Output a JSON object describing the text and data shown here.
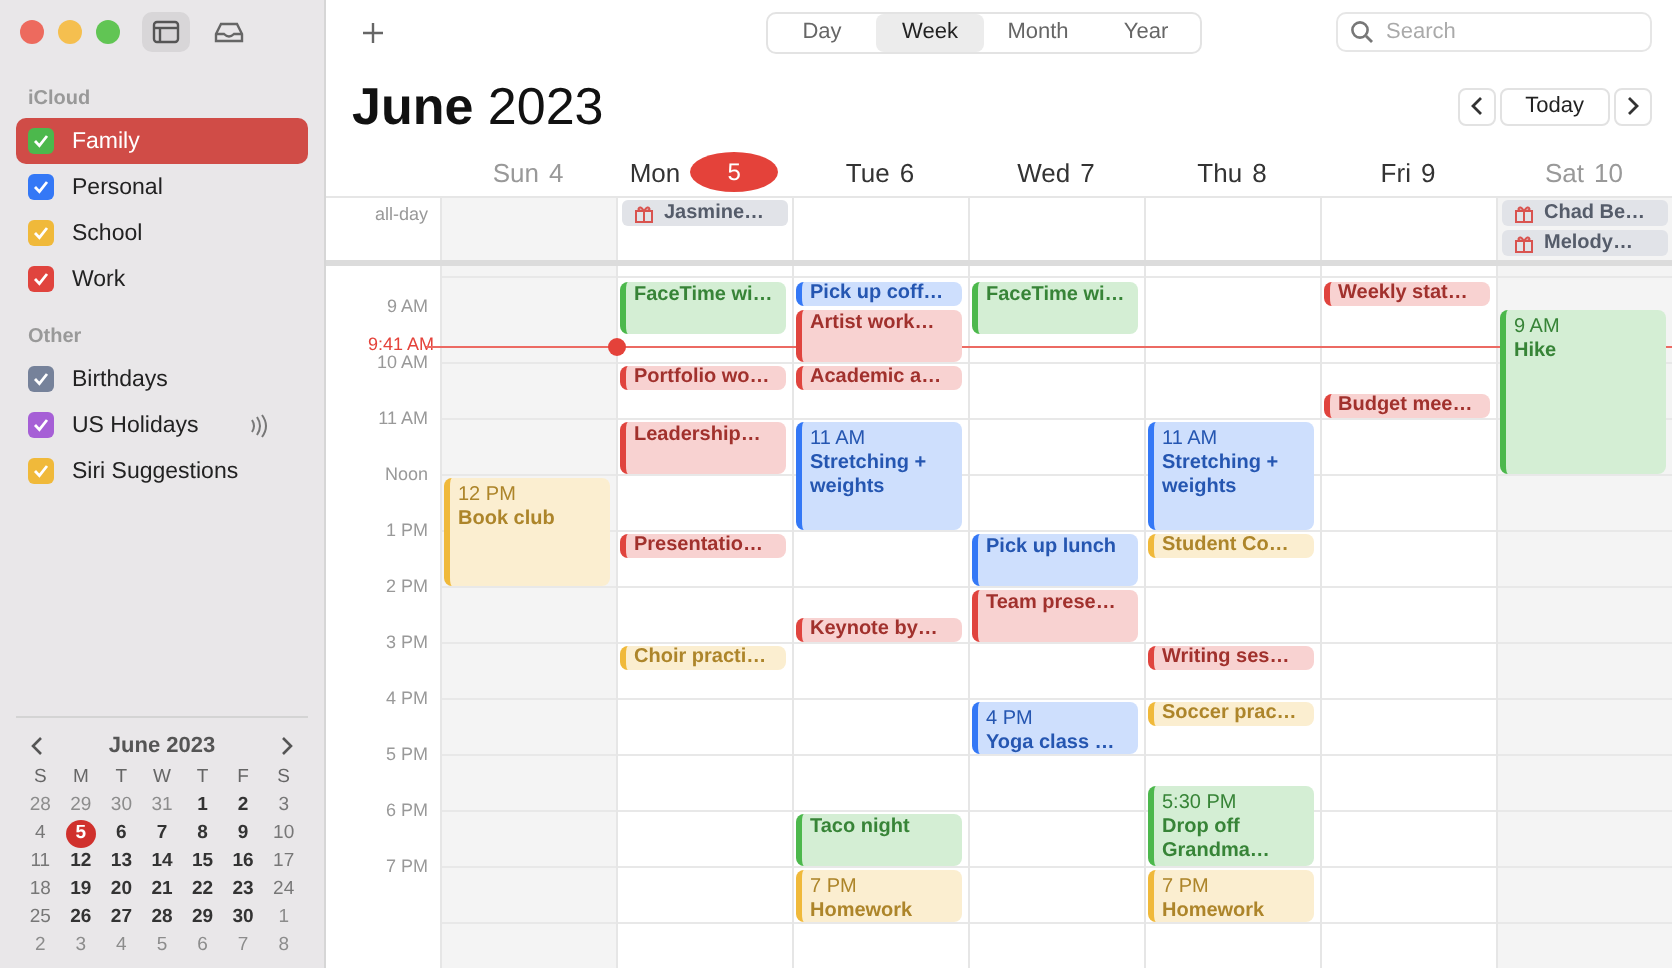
{
  "sidebar": {
    "sections": [
      {
        "title": "iCloud",
        "calendars": [
          {
            "name": "Family",
            "color": "#4cb84c",
            "checked": true,
            "selected": true,
            "shared": false
          },
          {
            "name": "Personal",
            "color": "#3478f6",
            "checked": true,
            "selected": false,
            "shared": false
          },
          {
            "name": "School",
            "color": "#f0b93a",
            "checked": true,
            "selected": false,
            "shared": false
          },
          {
            "name": "Work",
            "color": "#e0443e",
            "checked": true,
            "selected": false,
            "shared": false
          }
        ]
      },
      {
        "title": "Other",
        "calendars": [
          {
            "name": "Birthdays",
            "color": "#76829a",
            "checked": true,
            "selected": false,
            "shared": false
          },
          {
            "name": "US Holidays",
            "color": "#a65fd6",
            "checked": true,
            "selected": false,
            "shared": true
          },
          {
            "name": "Siri Suggestions",
            "color": "#f0b93a",
            "checked": true,
            "selected": false,
            "shared": false
          }
        ]
      }
    ],
    "mini_calendar": {
      "title": "June 2023",
      "weekdays": [
        "S",
        "M",
        "T",
        "W",
        "T",
        "F",
        "S"
      ],
      "weeks": [
        [
          {
            "d": "28",
            "in_month": false,
            "selected": false
          },
          {
            "d": "29",
            "in_month": false,
            "selected": false
          },
          {
            "d": "30",
            "in_month": false,
            "selected": false
          },
          {
            "d": "31",
            "in_month": false,
            "selected": false
          },
          {
            "d": "1",
            "in_month": true,
            "selected": false
          },
          {
            "d": "2",
            "in_month": true,
            "selected": false
          },
          {
            "d": "3",
            "in_month": true,
            "selected": false
          }
        ],
        [
          {
            "d": "4",
            "in_month": true,
            "selected": false
          },
          {
            "d": "5",
            "in_month": true,
            "selected": true
          },
          {
            "d": "6",
            "in_month": true,
            "selected": false
          },
          {
            "d": "7",
            "in_month": true,
            "selected": false
          },
          {
            "d": "8",
            "in_month": true,
            "selected": false
          },
          {
            "d": "9",
            "in_month": true,
            "selected": false
          },
          {
            "d": "10",
            "in_month": true,
            "selected": false
          }
        ],
        [
          {
            "d": "11",
            "in_month": true,
            "selected": false
          },
          {
            "d": "12",
            "in_month": true,
            "selected": false
          },
          {
            "d": "13",
            "in_month": true,
            "selected": false
          },
          {
            "d": "14",
            "in_month": true,
            "selected": false
          },
          {
            "d": "15",
            "in_month": true,
            "selected": false
          },
          {
            "d": "16",
            "in_month": true,
            "selected": false
          },
          {
            "d": "17",
            "in_month": true,
            "selected": false
          }
        ],
        [
          {
            "d": "18",
            "in_month": true,
            "selected": false
          },
          {
            "d": "19",
            "in_month": true,
            "selected": false
          },
          {
            "d": "20",
            "in_month": true,
            "selected": false
          },
          {
            "d": "21",
            "in_month": true,
            "selected": false
          },
          {
            "d": "22",
            "in_month": true,
            "selected": false
          },
          {
            "d": "23",
            "in_month": true,
            "selected": false
          },
          {
            "d": "24",
            "in_month": true,
            "selected": false
          }
        ],
        [
          {
            "d": "25",
            "in_month": true,
            "selected": false
          },
          {
            "d": "26",
            "in_month": true,
            "selected": false
          },
          {
            "d": "27",
            "in_month": true,
            "selected": false
          },
          {
            "d": "28",
            "in_month": true,
            "selected": false
          },
          {
            "d": "29",
            "in_month": true,
            "selected": false
          },
          {
            "d": "30",
            "in_month": true,
            "selected": false
          },
          {
            "d": "1",
            "in_month": false,
            "selected": false
          }
        ],
        [
          {
            "d": "2",
            "in_month": false,
            "selected": false
          },
          {
            "d": "3",
            "in_month": false,
            "selected": false
          },
          {
            "d": "4",
            "in_month": false,
            "selected": false
          },
          {
            "d": "5",
            "in_month": false,
            "selected": false
          },
          {
            "d": "6",
            "in_month": false,
            "selected": false
          },
          {
            "d": "7",
            "in_month": false,
            "selected": false
          },
          {
            "d": "8",
            "in_month": false,
            "selected": false
          }
        ]
      ]
    }
  },
  "toolbar": {
    "views": [
      {
        "label": "Day",
        "selected": false
      },
      {
        "label": "Week",
        "selected": true
      },
      {
        "label": "Month",
        "selected": false
      },
      {
        "label": "Year",
        "selected": false
      }
    ],
    "search": {
      "placeholder": "Search"
    }
  },
  "title": "**June** 2023",
  "today_button": "Today",
  "all_day_label": "all-day",
  "hours": [
    "9 AM",
    "10 AM",
    "11 AM",
    "Noon",
    "1 PM",
    "2 PM",
    "3 PM",
    "4 PM",
    "5 PM",
    "6 PM",
    "7 PM"
  ],
  "now": {
    "label": "9:41 AM"
  },
  "days": [
    {
      "name": "Sun",
      "date": "4",
      "weekend": true,
      "today": false,
      "events": [
        {
          "title": "Book club",
          "time": "12 PM",
          "color": "#f0b93a"
        }
      ]
    },
    {
      "name": "Mon",
      "date": "5",
      "weekend": false,
      "today": true,
      "all_day": [
        {
          "title": "Jasmine…",
          "kind": "birthday"
        }
      ],
      "events": [
        {
          "title": "FaceTime wi…",
          "color": "#4cb84c"
        },
        {
          "title": "Portfolio wo…",
          "color": "#e0443e"
        },
        {
          "title": "Leadership…",
          "color": "#e0443e"
        },
        {
          "title": "Presentatio…",
          "color": "#e0443e"
        },
        {
          "title": "Choir practi…",
          "color": "#f0b93a"
        }
      ]
    },
    {
      "name": "Tue",
      "date": "6",
      "weekend": false,
      "today": false,
      "events": [
        {
          "title": "Pick up coff…",
          "color": "#3478f6"
        },
        {
          "title": "Artist work…",
          "color": "#e0443e"
        },
        {
          "title": "Academic a…",
          "color": "#e0443e"
        },
        {
          "title": "Stretching + weights",
          "time": "11 AM",
          "color": "#3478f6"
        },
        {
          "title": "Keynote by…",
          "color": "#e0443e"
        },
        {
          "title": "Taco night",
          "color": "#4cb84c"
        },
        {
          "title": "Homework",
          "time": "7 PM",
          "color": "#f0b93a"
        }
      ]
    },
    {
      "name": "Wed",
      "date": "7",
      "weekend": false,
      "today": false,
      "events": [
        {
          "title": "FaceTime wi…",
          "color": "#4cb84c"
        },
        {
          "title": "Pick up lunch",
          "color": "#3478f6"
        },
        {
          "title": "Team prese…",
          "color": "#e0443e"
        },
        {
          "title": "Yoga class …",
          "time": "4 PM",
          "color": "#3478f6"
        }
      ]
    },
    {
      "name": "Thu",
      "date": "8",
      "weekend": false,
      "today": false,
      "events": [
        {
          "title": "Stretching + weights",
          "time": "11 AM",
          "color": "#3478f6"
        },
        {
          "title": "Student Co…",
          "color": "#f0b93a"
        },
        {
          "title": "Writing ses…",
          "color": "#e0443e"
        },
        {
          "title": "Soccer prac…",
          "color": "#f0b93a"
        },
        {
          "title": "Drop off Grandma…",
          "time": "5:30 PM",
          "color": "#4cb84c"
        },
        {
          "title": "Homework",
          "time": "7 PM",
          "color": "#f0b93a"
        }
      ]
    },
    {
      "name": "Fri",
      "date": "9",
      "weekend": false,
      "today": false,
      "events": [
        {
          "title": "Weekly stat…",
          "color": "#e0443e"
        },
        {
          "title": "Budget mee…",
          "color": "#e0443e"
        }
      ]
    },
    {
      "name": "Sat",
      "date": "10",
      "weekend": true,
      "today": false,
      "all_day": [
        {
          "title": "Chad Be…",
          "kind": "birthday"
        },
        {
          "title": "Melody…",
          "kind": "birthday"
        }
      ],
      "events": [
        {
          "title": "Hike",
          "time": "9 AM",
          "color": "#4cb84c"
        }
      ]
    }
  ]
}
